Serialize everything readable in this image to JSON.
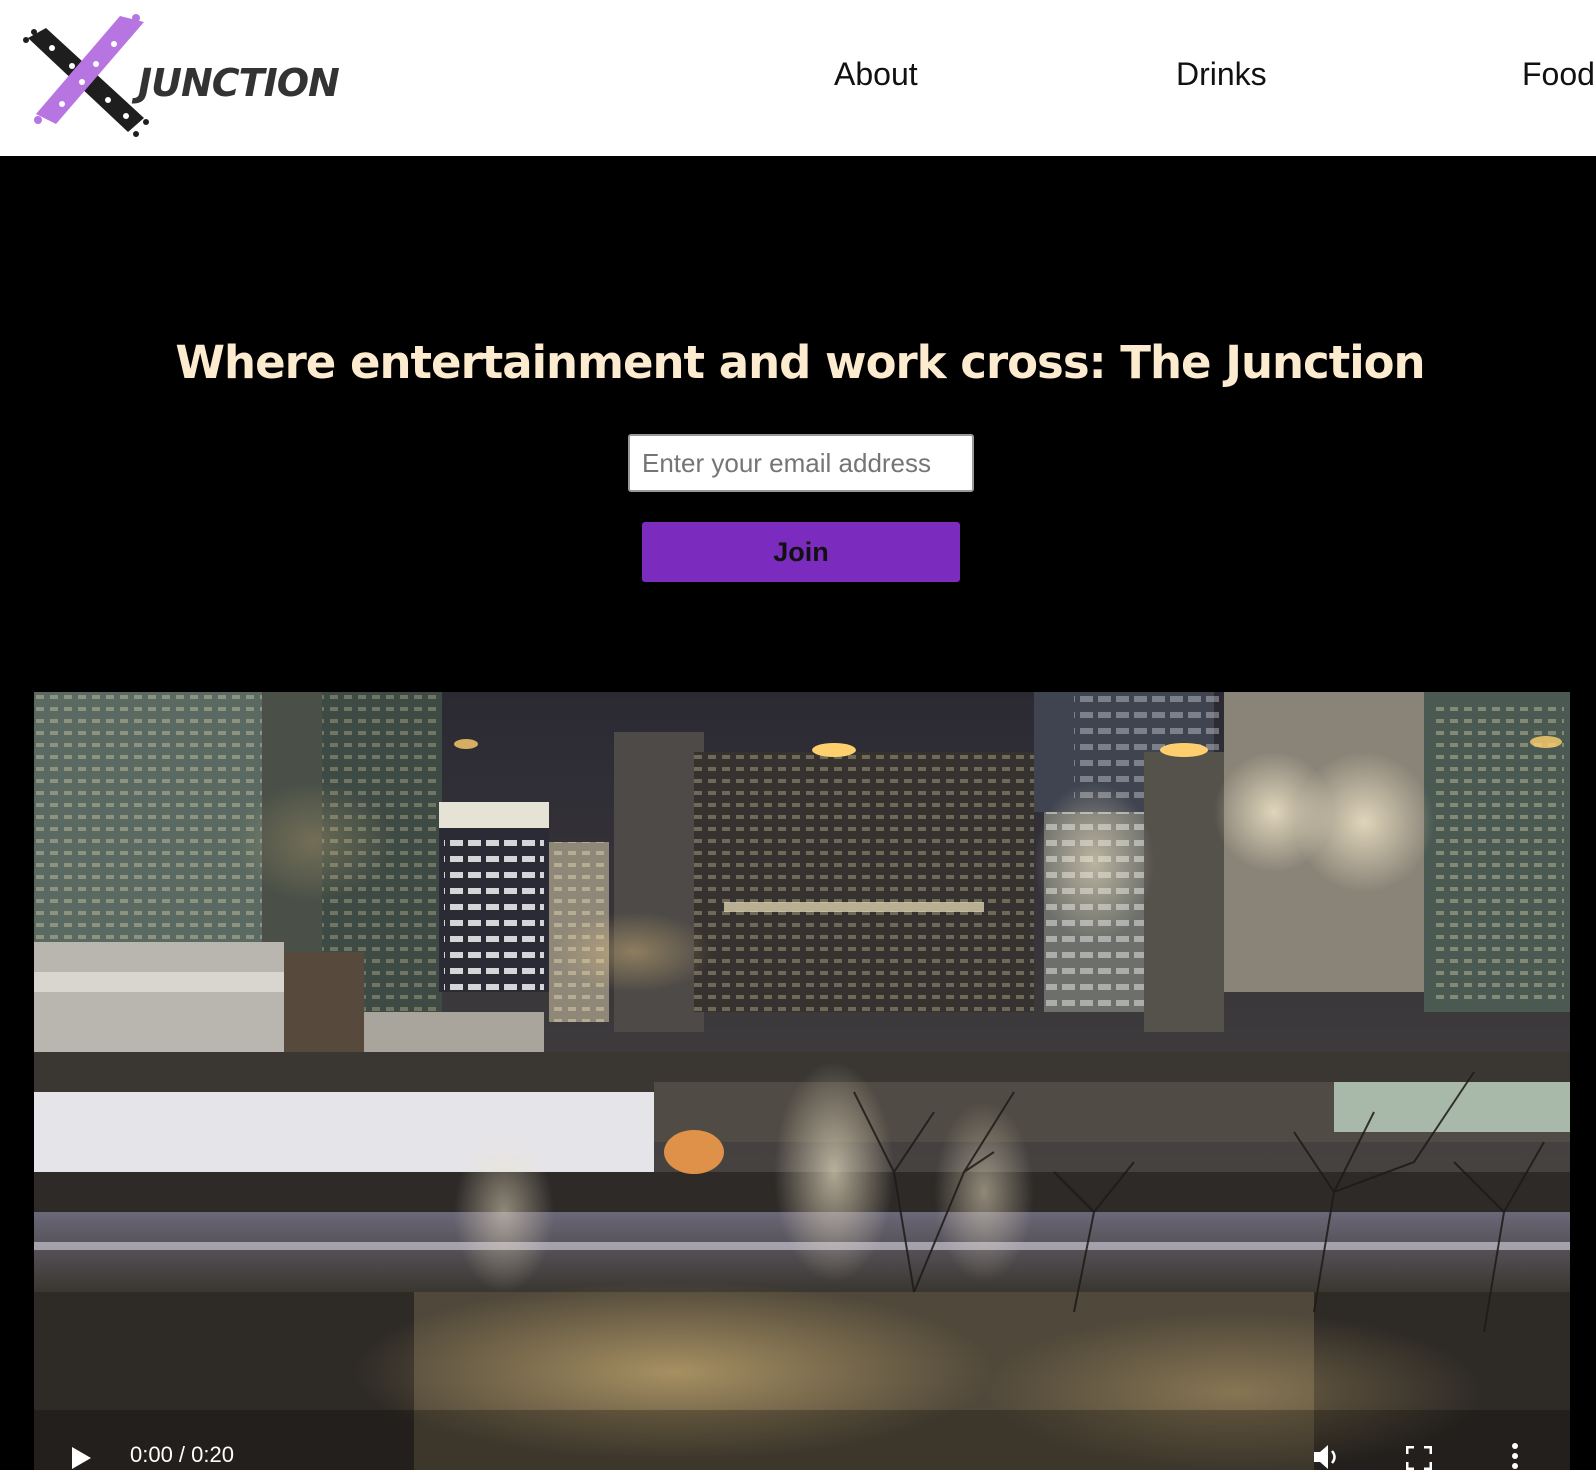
{
  "brand": {
    "name": "JUNCTION",
    "colors": {
      "logo_purple": "#b675e0",
      "logo_dark": "#1e1e1e",
      "title_cream": "#fdebd0",
      "button_purple": "#7b2cbf",
      "background": "#000000"
    }
  },
  "nav": {
    "items": [
      {
        "label": "About"
      },
      {
        "label": "Drinks"
      },
      {
        "label": "Food"
      }
    ]
  },
  "hero": {
    "title": "Where entertainment and work cross: The Junction",
    "email_placeholder": "Enter your email address",
    "email_value": "",
    "join_label": "Join"
  },
  "video": {
    "time": "0:00 / 0:20",
    "icons": [
      "play-icon",
      "volume-icon",
      "fullscreen-icon",
      "more-options-icon"
    ]
  }
}
